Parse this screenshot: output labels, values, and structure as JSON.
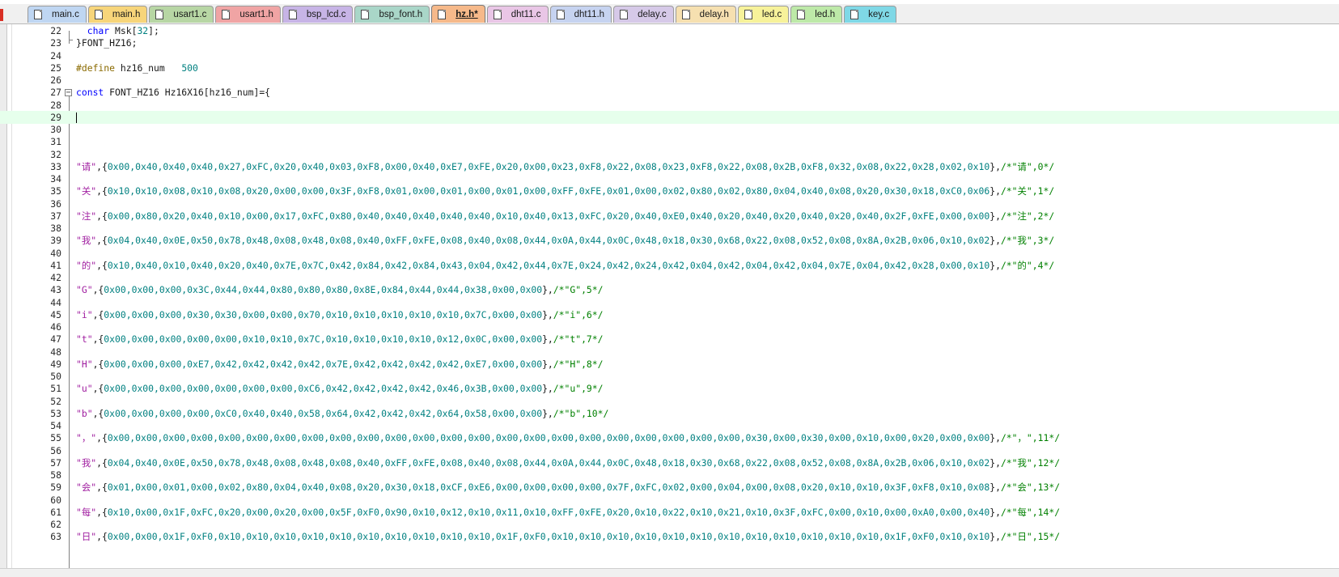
{
  "tabs": [
    {
      "label": "main.c",
      "color": "#bfd6f2",
      "active": false
    },
    {
      "label": "main.h",
      "color": "#f7d57a",
      "active": false
    },
    {
      "label": "usart1.c",
      "color": "#b7d6a4",
      "active": false
    },
    {
      "label": "usart1.h",
      "color": "#f0a4a4",
      "active": false
    },
    {
      "label": "bsp_lcd.c",
      "color": "#c7b4e6",
      "active": false
    },
    {
      "label": "bsp_font.h",
      "color": "#a9d6c8",
      "active": false
    },
    {
      "label": "hz.h*",
      "color": "#f6b98a",
      "active": true
    },
    {
      "label": "dht11.c",
      "color": "#e9c6e6",
      "active": false
    },
    {
      "label": "dht11.h",
      "color": "#c6d3f0",
      "active": false
    },
    {
      "label": "delay.c",
      "color": "#d6c9e8",
      "active": false
    },
    {
      "label": "delay.h",
      "color": "#f6e0b0",
      "active": false
    },
    {
      "label": "led.c",
      "color": "#f7f29a",
      "active": false
    },
    {
      "label": "led.h",
      "color": "#bde9a8",
      "active": false
    },
    {
      "label": "key.c",
      "color": "#7fd8e6",
      "active": false
    }
  ],
  "editor": {
    "current_line": "29",
    "lines": [
      {
        "n": "22",
        "segs": [
          {
            "c": "",
            "t": "  "
          },
          {
            "c": "kw",
            "t": "char"
          },
          {
            "c": "",
            "t": " Msk["
          },
          {
            "c": "num",
            "t": "32"
          },
          {
            "c": "",
            "t": "];"
          }
        ]
      },
      {
        "n": "23",
        "segs": [
          {
            "c": "",
            "t": "}FONT_HZ16;"
          }
        ]
      },
      {
        "n": "24",
        "segs": []
      },
      {
        "n": "25",
        "segs": [
          {
            "c": "pp",
            "t": "#define"
          },
          {
            "c": "",
            "t": " hz16_num   "
          },
          {
            "c": "num",
            "t": "500"
          }
        ]
      },
      {
        "n": "26",
        "segs": []
      },
      {
        "n": "27",
        "segs": [
          {
            "c": "kw",
            "t": "const"
          },
          {
            "c": "",
            "t": " FONT_HZ16 Hz16X16[hz16_num]={"
          }
        ]
      },
      {
        "n": "28",
        "segs": []
      },
      {
        "n": "29",
        "segs": []
      },
      {
        "n": "30",
        "segs": []
      },
      {
        "n": "31",
        "segs": []
      },
      {
        "n": "32",
        "segs": []
      },
      {
        "n": "33",
        "segs": [
          {
            "c": "str",
            "t": "\"请\""
          },
          {
            "c": "",
            "t": ",{"
          },
          {
            "c": "hex",
            "t": "0x00,0x40,0x40,0x40,0x27,0xFC,0x20,0x40,0x03,0xF8,0x00,0x40,0xE7,0xFE,0x20,0x00,0x23,0xF8,0x22,0x08,0x23,0xF8,0x22,0x08,0x2B,0xF8,0x32,0x08,0x22,0x28,0x02,0x10"
          },
          {
            "c": "",
            "t": "},"
          },
          {
            "c": "cmt",
            "t": "/*\"请\",0*/"
          }
        ]
      },
      {
        "n": "34",
        "segs": []
      },
      {
        "n": "35",
        "segs": [
          {
            "c": "str",
            "t": "\"关\""
          },
          {
            "c": "",
            "t": ",{"
          },
          {
            "c": "hex",
            "t": "0x10,0x10,0x08,0x10,0x08,0x20,0x00,0x00,0x3F,0xF8,0x01,0x00,0x01,0x00,0x01,0x00,0xFF,0xFE,0x01,0x00,0x02,0x80,0x02,0x80,0x04,0x40,0x08,0x20,0x30,0x18,0xC0,0x06"
          },
          {
            "c": "",
            "t": "},"
          },
          {
            "c": "cmt",
            "t": "/*\"关\",1*/"
          }
        ]
      },
      {
        "n": "36",
        "segs": []
      },
      {
        "n": "37",
        "segs": [
          {
            "c": "str",
            "t": "\"注\""
          },
          {
            "c": "",
            "t": ",{"
          },
          {
            "c": "hex",
            "t": "0x00,0x80,0x20,0x40,0x10,0x00,0x17,0xFC,0x80,0x40,0x40,0x40,0x40,0x40,0x10,0x40,0x13,0xFC,0x20,0x40,0xE0,0x40,0x20,0x40,0x20,0x40,0x20,0x40,0x2F,0xFE,0x00,0x00"
          },
          {
            "c": "",
            "t": "},"
          },
          {
            "c": "cmt",
            "t": "/*\"注\",2*/"
          }
        ]
      },
      {
        "n": "38",
        "segs": []
      },
      {
        "n": "39",
        "segs": [
          {
            "c": "str",
            "t": "\"我\""
          },
          {
            "c": "",
            "t": ",{"
          },
          {
            "c": "hex",
            "t": "0x04,0x40,0x0E,0x50,0x78,0x48,0x08,0x48,0x08,0x40,0xFF,0xFE,0x08,0x40,0x08,0x44,0x0A,0x44,0x0C,0x48,0x18,0x30,0x68,0x22,0x08,0x52,0x08,0x8A,0x2B,0x06,0x10,0x02"
          },
          {
            "c": "",
            "t": "},"
          },
          {
            "c": "cmt",
            "t": "/*\"我\",3*/"
          }
        ]
      },
      {
        "n": "40",
        "segs": []
      },
      {
        "n": "41",
        "segs": [
          {
            "c": "str",
            "t": "\"的\""
          },
          {
            "c": "",
            "t": ",{"
          },
          {
            "c": "hex",
            "t": "0x10,0x40,0x10,0x40,0x20,0x40,0x7E,0x7C,0x42,0x84,0x42,0x84,0x43,0x04,0x42,0x44,0x7E,0x24,0x42,0x24,0x42,0x04,0x42,0x04,0x42,0x04,0x7E,0x04,0x42,0x28,0x00,0x10"
          },
          {
            "c": "",
            "t": "},"
          },
          {
            "c": "cmt",
            "t": "/*\"的\",4*/"
          }
        ]
      },
      {
        "n": "42",
        "segs": []
      },
      {
        "n": "43",
        "segs": [
          {
            "c": "str",
            "t": "\"G\""
          },
          {
            "c": "",
            "t": ",{"
          },
          {
            "c": "hex",
            "t": "0x00,0x00,0x00,0x3C,0x44,0x44,0x80,0x80,0x80,0x8E,0x84,0x44,0x44,0x38,0x00,0x00"
          },
          {
            "c": "",
            "t": "},"
          },
          {
            "c": "cmt",
            "t": "/*\"G\",5*/"
          }
        ]
      },
      {
        "n": "44",
        "segs": []
      },
      {
        "n": "45",
        "segs": [
          {
            "c": "str",
            "t": "\"i\""
          },
          {
            "c": "",
            "t": ",{"
          },
          {
            "c": "hex",
            "t": "0x00,0x00,0x00,0x30,0x30,0x00,0x00,0x70,0x10,0x10,0x10,0x10,0x10,0x7C,0x00,0x00"
          },
          {
            "c": "",
            "t": "},"
          },
          {
            "c": "cmt",
            "t": "/*\"i\",6*/"
          }
        ]
      },
      {
        "n": "46",
        "segs": []
      },
      {
        "n": "47",
        "segs": [
          {
            "c": "str",
            "t": "\"t\""
          },
          {
            "c": "",
            "t": ",{"
          },
          {
            "c": "hex",
            "t": "0x00,0x00,0x00,0x00,0x00,0x10,0x10,0x7C,0x10,0x10,0x10,0x10,0x12,0x0C,0x00,0x00"
          },
          {
            "c": "",
            "t": "},"
          },
          {
            "c": "cmt",
            "t": "/*\"t\",7*/"
          }
        ]
      },
      {
        "n": "48",
        "segs": []
      },
      {
        "n": "49",
        "segs": [
          {
            "c": "str",
            "t": "\"H\""
          },
          {
            "c": "",
            "t": ",{"
          },
          {
            "c": "hex",
            "t": "0x00,0x00,0x00,0xE7,0x42,0x42,0x42,0x42,0x7E,0x42,0x42,0x42,0x42,0xE7,0x00,0x00"
          },
          {
            "c": "",
            "t": "},"
          },
          {
            "c": "cmt",
            "t": "/*\"H\",8*/"
          }
        ]
      },
      {
        "n": "50",
        "segs": []
      },
      {
        "n": "51",
        "segs": [
          {
            "c": "str",
            "t": "\"u\""
          },
          {
            "c": "",
            "t": ",{"
          },
          {
            "c": "hex",
            "t": "0x00,0x00,0x00,0x00,0x00,0x00,0x00,0xC6,0x42,0x42,0x42,0x42,0x46,0x3B,0x00,0x00"
          },
          {
            "c": "",
            "t": "},"
          },
          {
            "c": "cmt",
            "t": "/*\"u\",9*/"
          }
        ]
      },
      {
        "n": "52",
        "segs": []
      },
      {
        "n": "53",
        "segs": [
          {
            "c": "str",
            "t": "\"b\""
          },
          {
            "c": "",
            "t": ",{"
          },
          {
            "c": "hex",
            "t": "0x00,0x00,0x00,0x00,0xC0,0x40,0x40,0x58,0x64,0x42,0x42,0x42,0x64,0x58,0x00,0x00"
          },
          {
            "c": "",
            "t": "},"
          },
          {
            "c": "cmt",
            "t": "/*\"b\",10*/"
          }
        ]
      },
      {
        "n": "54",
        "segs": []
      },
      {
        "n": "55",
        "segs": [
          {
            "c": "str",
            "t": "\"，\""
          },
          {
            "c": "",
            "t": ",{"
          },
          {
            "c": "hex",
            "t": "0x00,0x00,0x00,0x00,0x00,0x00,0x00,0x00,0x00,0x00,0x00,0x00,0x00,0x00,0x00,0x00,0x00,0x00,0x00,0x00,0x00,0x00,0x00,0x30,0x00,0x30,0x00,0x10,0x00,0x20,0x00,0x00"
          },
          {
            "c": "",
            "t": "},"
          },
          {
            "c": "cmt",
            "t": "/*\"，\",11*/"
          }
        ]
      },
      {
        "n": "56",
        "segs": []
      },
      {
        "n": "57",
        "segs": [
          {
            "c": "str",
            "t": "\"我\""
          },
          {
            "c": "",
            "t": ",{"
          },
          {
            "c": "hex",
            "t": "0x04,0x40,0x0E,0x50,0x78,0x48,0x08,0x48,0x08,0x40,0xFF,0xFE,0x08,0x40,0x08,0x44,0x0A,0x44,0x0C,0x48,0x18,0x30,0x68,0x22,0x08,0x52,0x08,0x8A,0x2B,0x06,0x10,0x02"
          },
          {
            "c": "",
            "t": "},"
          },
          {
            "c": "cmt",
            "t": "/*\"我\",12*/"
          }
        ]
      },
      {
        "n": "58",
        "segs": []
      },
      {
        "n": "59",
        "segs": [
          {
            "c": "str",
            "t": "\"会\""
          },
          {
            "c": "",
            "t": ",{"
          },
          {
            "c": "hex",
            "t": "0x01,0x00,0x01,0x00,0x02,0x80,0x04,0x40,0x08,0x20,0x30,0x18,0xCF,0xE6,0x00,0x00,0x00,0x00,0x7F,0xFC,0x02,0x00,0x04,0x00,0x08,0x20,0x10,0x10,0x3F,0xF8,0x10,0x08"
          },
          {
            "c": "",
            "t": "},"
          },
          {
            "c": "cmt",
            "t": "/*\"会\",13*/"
          }
        ]
      },
      {
        "n": "60",
        "segs": []
      },
      {
        "n": "61",
        "segs": [
          {
            "c": "str",
            "t": "\"每\""
          },
          {
            "c": "",
            "t": ",{"
          },
          {
            "c": "hex",
            "t": "0x10,0x00,0x1F,0xFC,0x20,0x00,0x20,0x00,0x5F,0xF0,0x90,0x10,0x12,0x10,0x11,0x10,0xFF,0xFE,0x20,0x10,0x22,0x10,0x21,0x10,0x3F,0xFC,0x00,0x10,0x00,0xA0,0x00,0x40"
          },
          {
            "c": "",
            "t": "},"
          },
          {
            "c": "cmt",
            "t": "/*\"每\",14*/"
          }
        ]
      },
      {
        "n": "62",
        "segs": []
      },
      {
        "n": "63",
        "segs": [
          {
            "c": "str",
            "t": "\"日\""
          },
          {
            "c": "",
            "t": ",{"
          },
          {
            "c": "hex",
            "t": "0x00,0x00,0x1F,0xF0,0x10,0x10,0x10,0x10,0x10,0x10,0x10,0x10,0x10,0x10,0x1F,0xF0,0x10,0x10,0x10,0x10,0x10,0x10,0x10,0x10,0x10,0x10,0x10,0x10,0x1F,0xF0,0x10,0x10"
          },
          {
            "c": "",
            "t": "},"
          },
          {
            "c": "cmt",
            "t": "/*\"日\",15*/"
          }
        ]
      }
    ]
  }
}
